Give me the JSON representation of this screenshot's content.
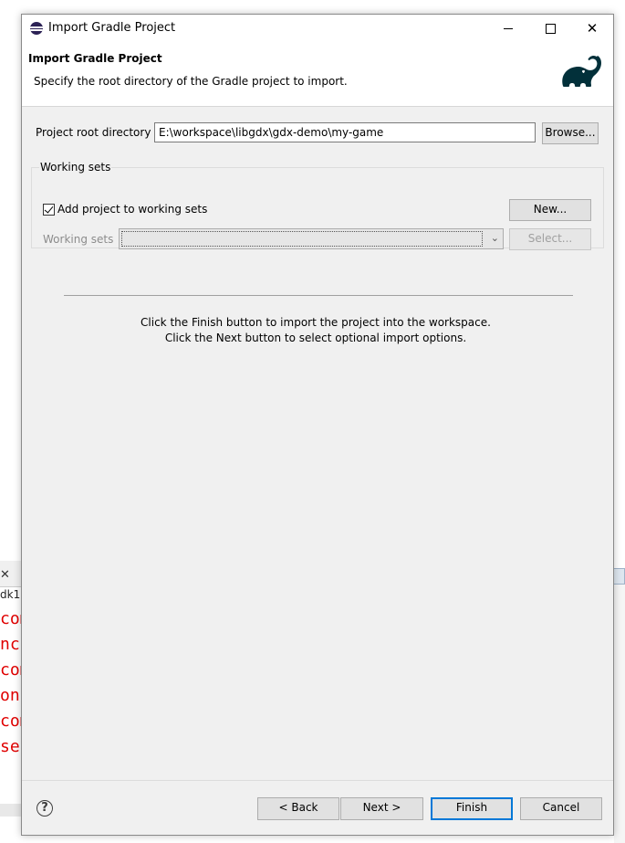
{
  "window": {
    "title": "Import Gradle Project"
  },
  "banner": {
    "title": "Import Gradle Project",
    "description": "Specify the root directory of the Gradle project to import."
  },
  "form": {
    "root_label": "Project root directory",
    "root_value": "E:\\workspace\\libgdx\\gdx-demo\\my-game",
    "browse_label": "Browse...",
    "working_sets_group": "Working sets",
    "add_to_working_sets_label": "Add project to working sets",
    "add_to_working_sets_checked": true,
    "new_label": "New...",
    "working_sets_label": "Working sets",
    "working_sets_value": "",
    "select_label": "Select..."
  },
  "info": {
    "line1": "Click the Finish button to import the project into the workspace.",
    "line2": "Click the Next button to select optional import options."
  },
  "footer": {
    "help": "?",
    "back_label": "< Back",
    "next_label": "Next >",
    "finish_label": "Finish",
    "cancel_label": "Cancel"
  },
  "background": {
    "tab_close": "✕",
    "tab_label": "dk1",
    "console_lines": [
      "com",
      "nc",
      "com",
      "on",
      "com",
      "ser"
    ]
  },
  "colors": {
    "accent": "#0078d7",
    "console_error": "#e00000",
    "gradle_icon": "#02303a"
  }
}
